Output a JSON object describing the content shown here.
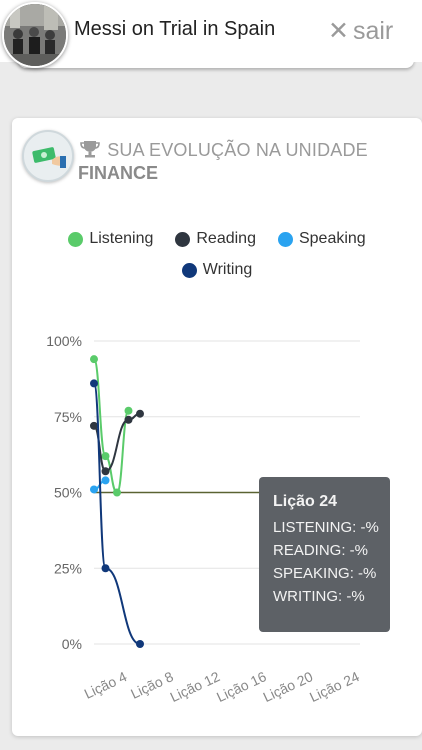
{
  "header": {
    "title": "Messi on Trial in Spain",
    "close_label": "sair"
  },
  "card": {
    "heading": "SUA EVOLUÇÃO NA UNIDADE",
    "unit": "FINANCE"
  },
  "colors": {
    "listening": "#5acb6a",
    "reading": "#2f3640",
    "speaking": "#2aa3f0",
    "writing": "#10387a",
    "threshold": "#5a6332"
  },
  "chart_data": {
    "type": "line",
    "y_ticks": [
      "0%",
      "25%",
      "50%",
      "75%",
      "100%"
    ],
    "x_ticks": [
      "Lição 4",
      "Lição 8",
      "Lição 12",
      "Lição 16",
      "Lição 20",
      "Lição 24"
    ],
    "ylim": [
      0,
      100
    ],
    "xlim": [
      0,
      24
    ],
    "threshold": 50,
    "legend": [
      "Listening",
      "Reading",
      "Speaking",
      "Writing"
    ],
    "series": [
      {
        "name": "Listening",
        "x": [
          1,
          2,
          3,
          4,
          5
        ],
        "y": [
          94,
          62,
          50,
          77,
          null
        ]
      },
      {
        "name": "Reading",
        "x": [
          1,
          2,
          4,
          5
        ],
        "y": [
          72,
          57,
          74,
          76
        ]
      },
      {
        "name": "Speaking",
        "x": [
          1,
          2
        ],
        "y": [
          51,
          54
        ]
      },
      {
        "name": "Writing",
        "x": [
          1,
          2,
          5
        ],
        "y": [
          86,
          25,
          0
        ]
      }
    ],
    "tooltip": {
      "title": "Lição 24",
      "lines": [
        "LISTENING: -%",
        "READING: -%",
        "SPEAKING: -%",
        "WRITING: -%"
      ]
    }
  }
}
